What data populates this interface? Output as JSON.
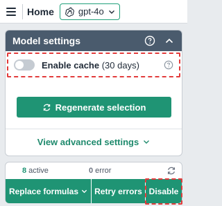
{
  "topbar": {
    "title": "Home",
    "model": {
      "label": "gpt-4o",
      "icon": "openai-logo-icon"
    }
  },
  "model_settings": {
    "title": "Model settings",
    "cache": {
      "label_bold": "Enable cache",
      "label_suffix": " (30 days)",
      "enabled": false
    },
    "regenerate_label": "Regenerate selection",
    "advanced_label": "View advanced settings"
  },
  "status": {
    "active_count": "8",
    "active_label": " active",
    "error_count": "0",
    "error_label": " error"
  },
  "actions": {
    "replace_label": "Replace formulas",
    "retry_label": "Retry errors",
    "disable_label": "Disable"
  },
  "colors": {
    "accent": "#1f9474",
    "header": "#4a5b6d",
    "highlight": "#e23b3b"
  }
}
